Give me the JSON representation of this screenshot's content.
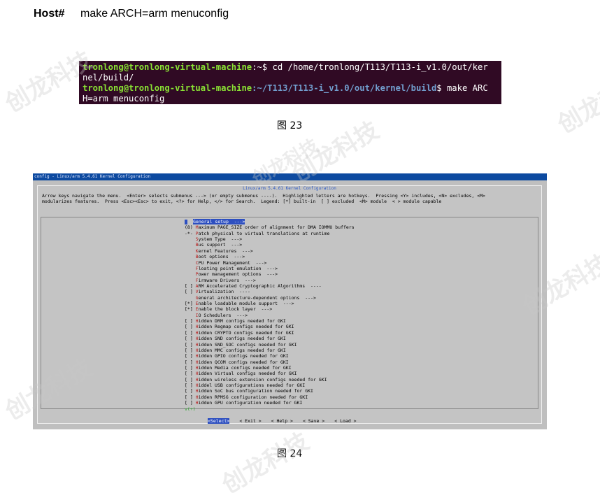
{
  "host": {
    "label": "Host#",
    "command": "make ARCH=arm menuconfig"
  },
  "terminal": {
    "line1_user": "tronlong@tronlong-virtual-machine",
    "line1_rest": ":~$ cd /home/tronlong/T113/T113-i_v1.0/out/ker",
    "line2": "nel/build/",
    "line3_user": "tronlong@tronlong-virtual-machine",
    "line3_path": ":~/T113/T113-i_v1.0/out/kernel/build",
    "line3_rest": "$ make ARC",
    "line4": "H=arm menuconfig"
  },
  "caption_23": "图 23",
  "caption_24": "图 24",
  "watermark": "创龙科技",
  "menuconfig": {
    "window_title": "config - Linux/arm 5.4.61 Kernel Configuration",
    "heading": "Linux/arm 5.4.61 Kernel Configuration",
    "help_line1": "Arrow keys navigate the menu.  <Enter> selects submenus ---> (or empty submenus ----).  Highlighted letters are hotkeys.  Pressing <Y> includes, <N> excludes, <M>",
    "help_line2": "modularizes features.  Press <Esc><Esc> to exit, <?> for Help, </> for Search.  Legend: [*] built-in  [ ] excluded  <M> module  < > module capable",
    "items": [
      "General setup  --->",
      "(8) Maximum PAGE_SIZE order of alignment for DMA IOMMU buffers",
      "-*- Patch physical to virtual translations at runtime",
      "    System Type  --->",
      "    Bus support  --->",
      "    Kernel Features  --->",
      "    Boot options  --->",
      "    CPU Power Management  --->",
      "    Floating point emulation  --->",
      "    Power management options  --->",
      "    Firmware Drivers  --->",
      "[ ] ARM Accelerated Cryptographic Algorithms  ----",
      "[ ] Virtualization  ----",
      "    General architecture-dependent options  --->",
      "[*] Enable loadable module support  --->",
      "[*] Enable the block layer  --->",
      "    IO Schedulers  --->",
      "[ ] Hidden DRM configs needed for GKI",
      "[ ] Hidden Regmap configs needed for GKI",
      "[ ] Hidden CRYPTO configs needed for GKI",
      "[ ] Hidden SND configs needed for GKI",
      "[ ] Hidden SND_SOC configs needed for GKI",
      "[ ] Hidden MMC configs needed for GKI",
      "[ ] Hidden GPIO configs needed for GKI",
      "[ ] Hidden QCOM configs needed for GKI",
      "[ ] Hidden Media configs needed for GKI",
      "[ ] Hidden Virtual configs needed for GKI",
      "[ ] Hidden wireless extension configs needed for GKI",
      "[ ] Hiddel USB configurations needed for GKI",
      "[ ] Hidden SoC bus configuration needed for GKI",
      "[ ] Hidden RPMSG configuration needed for GKI",
      "[ ] Hidden GPU configuration needed for GKI"
    ],
    "more_indicator": "v(+)",
    "buttons": [
      "<Select>",
      "< Exit >",
      "< Help >",
      "< Save >",
      "< Load >"
    ]
  }
}
